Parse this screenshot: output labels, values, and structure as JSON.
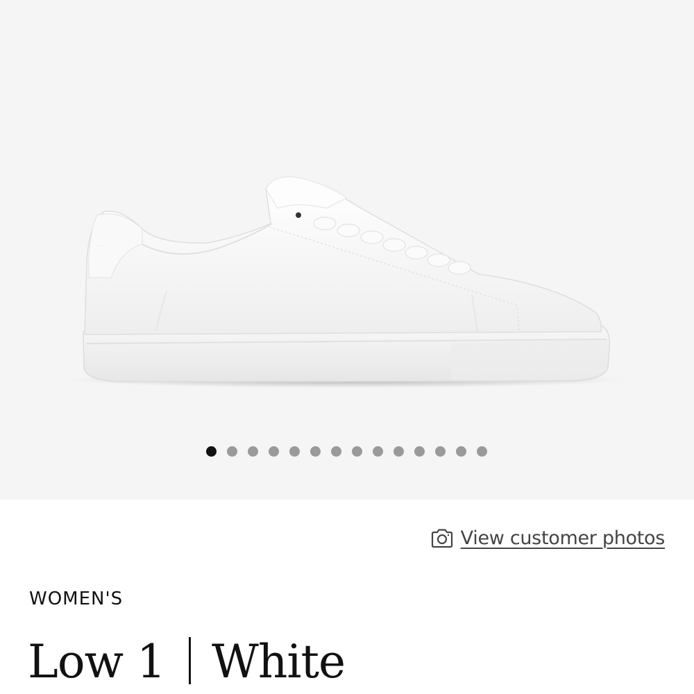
{
  "gallery": {
    "total_images": 14,
    "active_index": 0,
    "background": "#f5f5f5",
    "image": "white-leather-low-top-sneaker"
  },
  "customer_photos": {
    "icon": "camera-icon",
    "label": "View customer photos"
  },
  "product": {
    "category": "WOMEN'S",
    "model": "Low 1",
    "color": "White"
  }
}
